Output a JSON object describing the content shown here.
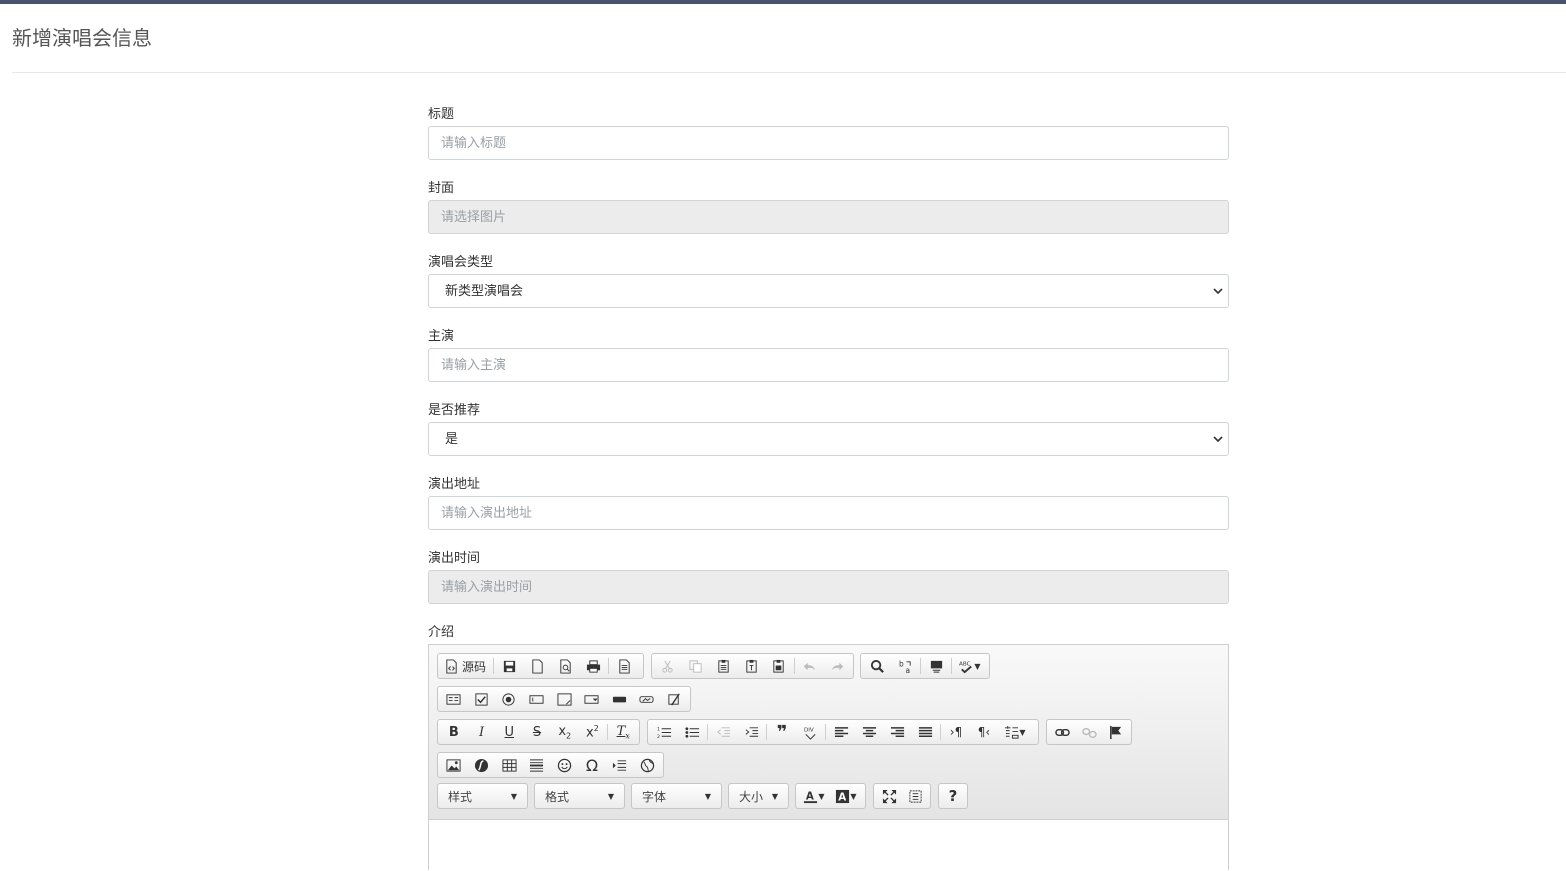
{
  "page": {
    "title": "新增演唱会信息"
  },
  "form": {
    "title_field": {
      "label": "标题",
      "placeholder": "请输入标题"
    },
    "cover_field": {
      "label": "封面",
      "placeholder": "请选择图片"
    },
    "type_field": {
      "label": "演唱会类型",
      "selected": "新类型演唱会"
    },
    "lead_field": {
      "label": "主演",
      "placeholder": "请输入主演"
    },
    "recommend_field": {
      "label": "是否推荐",
      "selected": "是"
    },
    "address_field": {
      "label": "演出地址",
      "placeholder": "请输入演出地址"
    },
    "time_field": {
      "label": "演出时间",
      "placeholder": "请输入演出时间"
    },
    "intro_field": {
      "label": "介绍"
    }
  },
  "editor": {
    "source_label": "源码",
    "style_combo": "样式",
    "format_combo": "格式",
    "font_combo": "字体",
    "size_combo": "大小",
    "help_label": "?"
  },
  "colors": {
    "topbar": "#4a5470",
    "readonly_bg": "#ececec"
  }
}
